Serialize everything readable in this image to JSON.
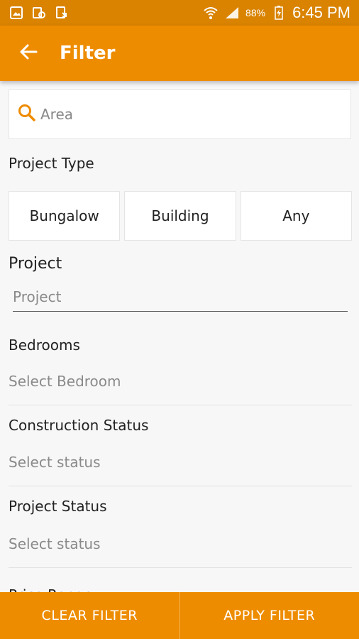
{
  "statusbar": {
    "battery": "88%",
    "time": "6:45 PM",
    "icons": [
      "gallery-icon",
      "recorder-icon",
      "download-icon",
      "wifi-icon",
      "signal-icon",
      "battery-icon"
    ]
  },
  "appbar": {
    "title": "Filter",
    "back_icon": "arrow-left-icon",
    "color": "#ee8c00"
  },
  "search": {
    "placeholder": "Area",
    "icon": "search-icon",
    "icon_color": "#ee8c00"
  },
  "project_type": {
    "label": "Project Type",
    "options": [
      "Bungalow",
      "Building",
      "Any"
    ]
  },
  "project": {
    "label": "Project",
    "placeholder": "Project"
  },
  "bedrooms": {
    "label": "Bedrooms",
    "value": "Select Bedroom"
  },
  "construction_status": {
    "label": "Construction Status",
    "value": "Select status"
  },
  "project_status": {
    "label": "Project Status",
    "value": "Select status"
  },
  "price_range": {
    "label": "Price Range"
  },
  "bottom": {
    "clear": "CLEAR FILTER",
    "apply": "APPLY FILTER"
  }
}
